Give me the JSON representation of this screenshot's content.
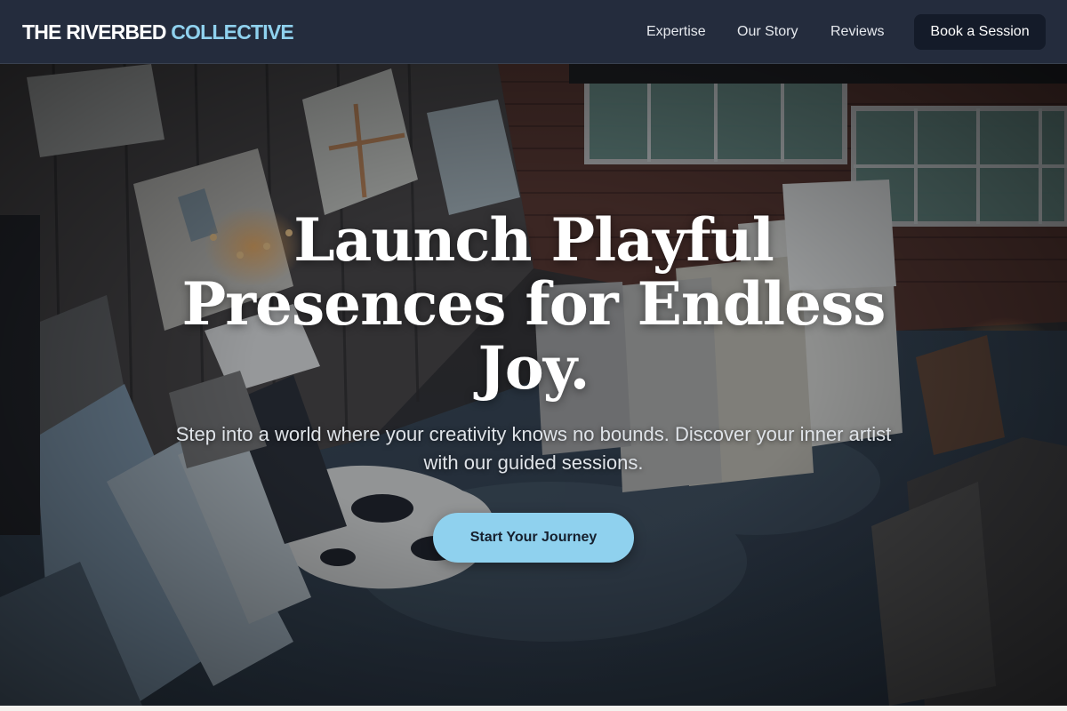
{
  "brand": {
    "name_part1": "THE RIVERBED",
    "name_part2": "COLLECTIVE"
  },
  "nav": {
    "links": [
      "Expertise",
      "Our Story",
      "Reviews"
    ],
    "cta_label": "Book a Session"
  },
  "hero": {
    "headline": "Launch Playful Presences for Endless Joy.",
    "subtext": "Step into a world where your creativity knows no bounds. Discover your inner artist with our guided sessions.",
    "cta_label": "Start Your Journey"
  },
  "colors": {
    "nav_bg": "#242c3d",
    "accent": "#8fd1ee",
    "button_dark": "#141b29"
  }
}
